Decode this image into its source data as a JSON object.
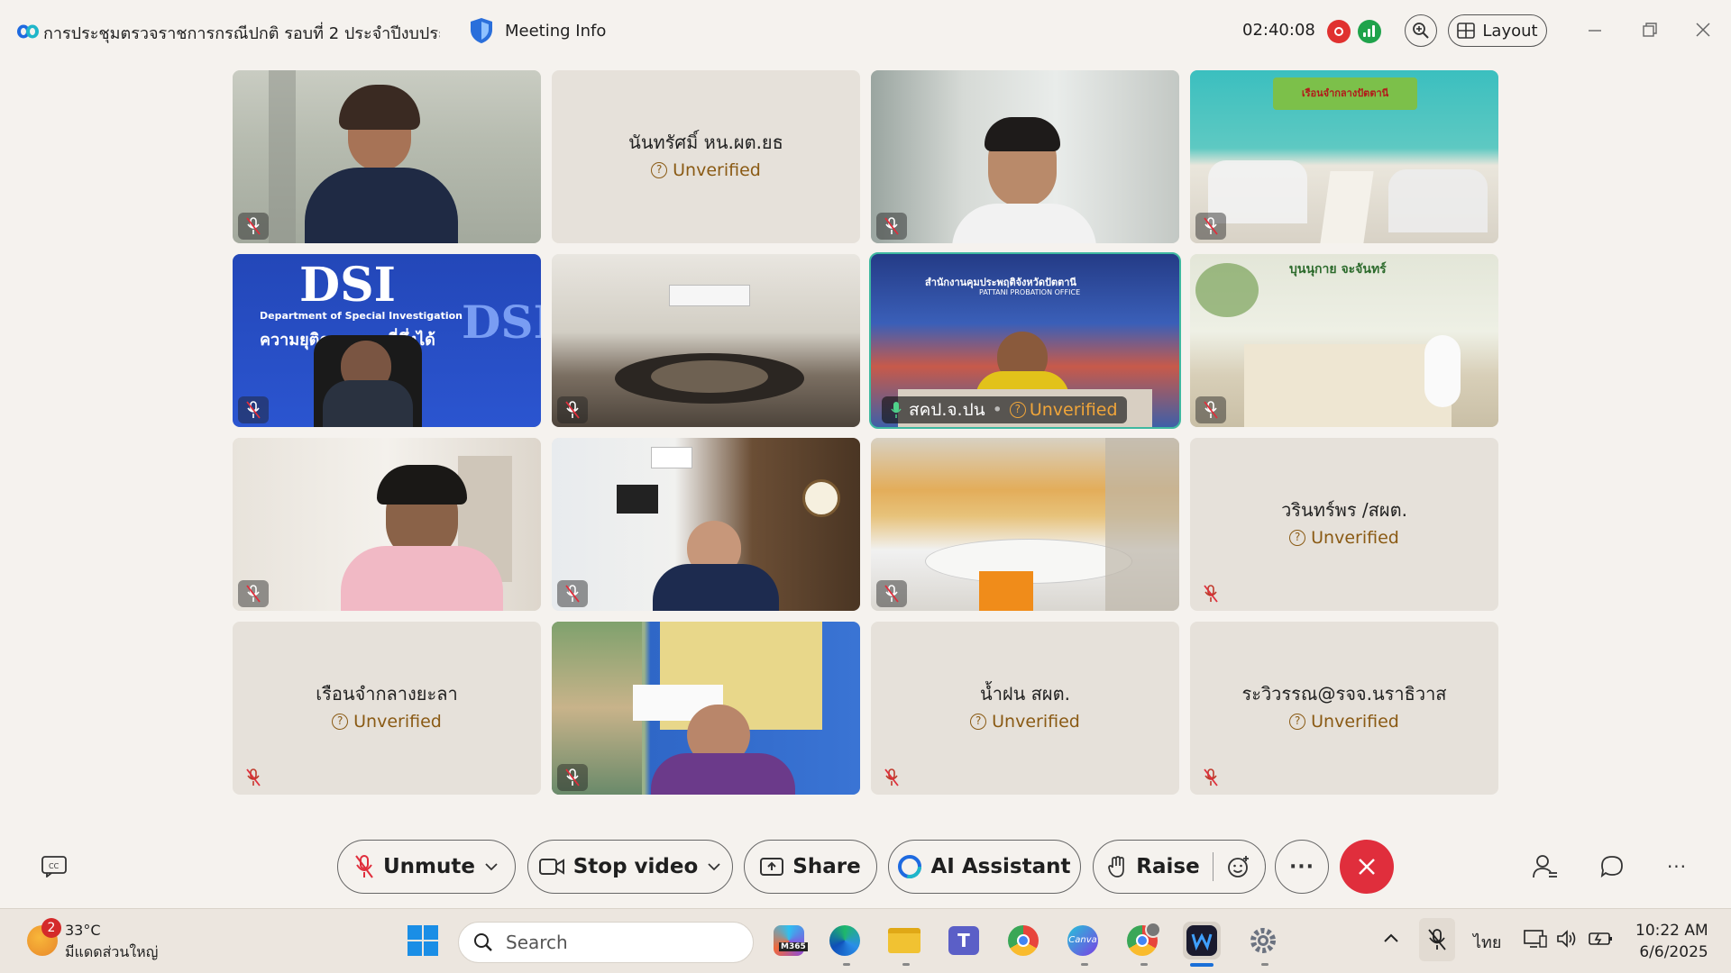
{
  "titlebar": {
    "meeting_title": "การประชุมตรวจราชการกรณีปกติ รอบที่ 2 ประจำปีงบประ...",
    "meeting_info_label": "Meeting Info",
    "timer": "02:40:08",
    "layout_label": "Layout"
  },
  "participants": [
    {
      "name": "",
      "unverified": "",
      "video": true,
      "muted": true
    },
    {
      "name": "นันทรัศมิ์ หน.ผต.ยธ",
      "unverified": "Unverified",
      "video": false,
      "muted": false
    },
    {
      "name": "",
      "unverified": "",
      "video": true,
      "muted": true
    },
    {
      "name": "",
      "unverified": "",
      "video": true,
      "muted": true
    },
    {
      "name": "",
      "unverified": "",
      "video": true,
      "muted": true
    },
    {
      "name": "",
      "unverified": "",
      "video": true,
      "muted": true
    },
    {
      "name": "สคป.จ.ปน",
      "unverified": "Unverified",
      "video": true,
      "muted": false,
      "active": true
    },
    {
      "name": "",
      "unverified": "",
      "video": true,
      "muted": true
    },
    {
      "name": "",
      "unverified": "",
      "video": true,
      "muted": true
    },
    {
      "name": "",
      "unverified": "",
      "video": true,
      "muted": true
    },
    {
      "name": "",
      "unverified": "",
      "video": true,
      "muted": true
    },
    {
      "name": "วรินทร์พร /สผต.",
      "unverified": "Unverified",
      "video": false,
      "muted": true
    },
    {
      "name": "เรือนจำกลางยะลา",
      "unverified": "Unverified",
      "video": false,
      "muted": true
    },
    {
      "name": "",
      "unverified": "",
      "video": true,
      "muted": true
    },
    {
      "name": "น้ำฝน สผต.",
      "unverified": "Unverified",
      "video": false,
      "muted": true
    },
    {
      "name": "ระวิวรรณ@รจจ.นราธิวาส",
      "unverified": "Unverified",
      "video": false,
      "muted": true
    }
  ],
  "video_texts": {
    "dsi_big": "DSI",
    "dsi_sub": "Department of Special Investigation",
    "dsi_thai": "ความยุติธรรม ... ที่พึ่งได้",
    "tile3_banner": "เรือนจำกลางปัตตานี",
    "tile6_sign": "สำนักงานคุมประพฤติจังหวัดปัตตานี",
    "tile6_sign_en": "PATTANI PROBATION OFFICE",
    "tile7_banner": "บุนนุกาย จะจันทร์"
  },
  "controls": {
    "unmute": "Unmute",
    "stop_video": "Stop video",
    "share": "Share",
    "ai_assistant": "AI Assistant",
    "raise": "Raise",
    "more": "···"
  },
  "taskbar": {
    "weather_badge": "2",
    "temperature": "33°C",
    "weather_desc": "มีแดดส่วนใหญ่",
    "search_placeholder": "Search",
    "language": "ไทย",
    "time": "10:22 AM",
    "date": "6/6/2025",
    "m365_label": "M365",
    "canva_label": "Canva"
  },
  "colors": {
    "accent_active": "#3fb8a0",
    "end_call": "#e02e3c",
    "unverified": "#8a5a14",
    "recording": "#e0312f",
    "signal": "#1fa34b"
  }
}
